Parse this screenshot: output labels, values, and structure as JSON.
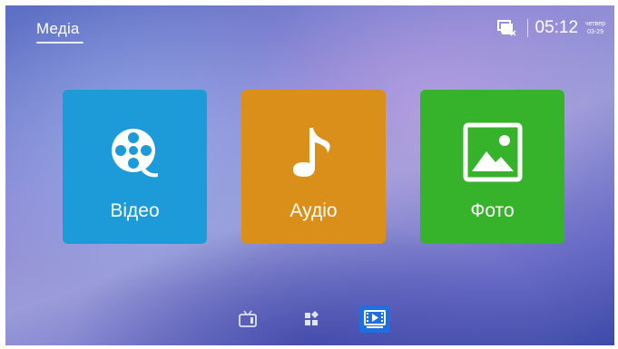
{
  "header": {
    "title": "Медіа",
    "time": "05:12",
    "weekday": "четвер",
    "date": "03-29",
    "network_icon": "network-computer-icon"
  },
  "tiles": [
    {
      "id": "video",
      "label": "Відео",
      "icon": "film-reel-icon",
      "color": "#1d9ad8"
    },
    {
      "id": "audio",
      "label": "Аудіо",
      "icon": "music-note-icon",
      "color": "#d98f1a"
    },
    {
      "id": "photo",
      "label": "Фото",
      "icon": "picture-icon",
      "color": "#36b32b"
    }
  ],
  "bottom_nav": [
    {
      "id": "tv",
      "icon": "tv-icon",
      "selected": false
    },
    {
      "id": "apps",
      "icon": "apps-grid-icon",
      "selected": false
    },
    {
      "id": "media",
      "icon": "media-player-icon",
      "selected": true,
      "accent": "#1f6fe0"
    }
  ]
}
